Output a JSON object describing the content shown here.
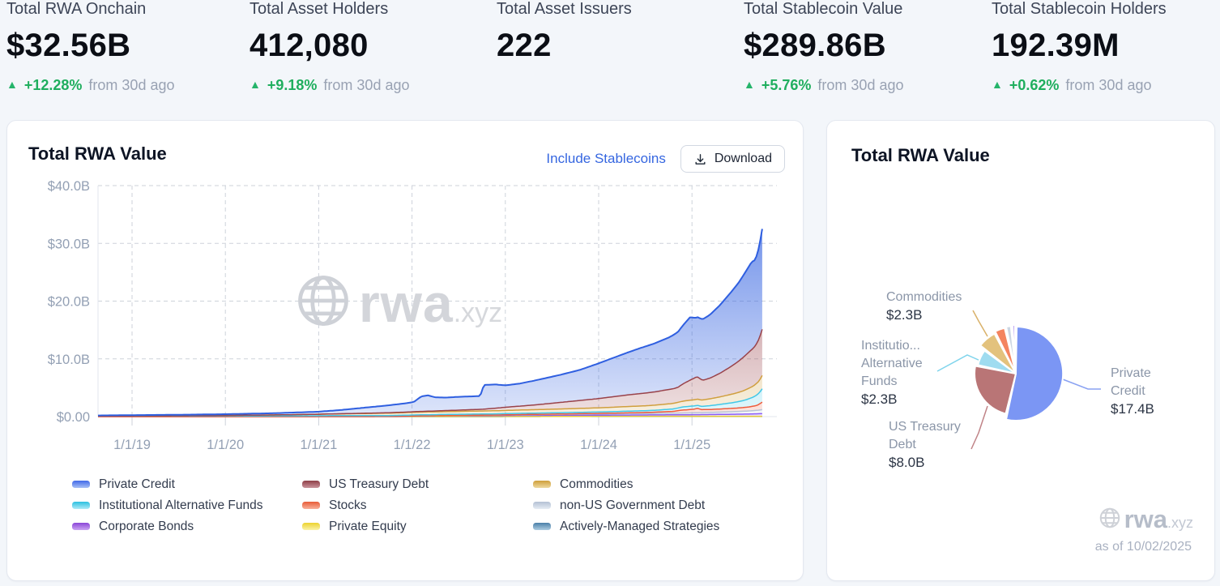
{
  "stats": [
    {
      "label": "Total RWA Onchain",
      "value": "$32.56B",
      "delta": "+12.28%",
      "delta_suffix": "from 30d ago"
    },
    {
      "label": "Total Asset Holders",
      "value": "412,080",
      "delta": "+9.18%",
      "delta_suffix": "from 30d ago"
    },
    {
      "label": "Total Asset Issuers",
      "value": "222",
      "delta": null,
      "delta_suffix": null
    },
    {
      "label": "Total Stablecoin Value",
      "value": "$289.86B",
      "delta": "+5.76%",
      "delta_suffix": "from 30d ago"
    },
    {
      "label": "Total Stablecoin Holders",
      "value": "192.39M",
      "delta": "+0.62%",
      "delta_suffix": "from 30d ago"
    }
  ],
  "main_card": {
    "title": "Total RWA Value",
    "include_stablecoins_label": "Include Stablecoins",
    "download_label": "Download"
  },
  "side_card": {
    "title": "Total RWA Value",
    "as_of": "as of 10/02/2025"
  },
  "watermark": {
    "text": "rwa",
    "suffix": ".xyz"
  },
  "colors": {
    "page_bg": "#f3f6fa",
    "link_blue": "#3566e0",
    "green_up": "#1fae5e",
    "axis_text": "#93a0b4",
    "grid_line": "#cdd2da"
  },
  "chart_data": [
    {
      "type": "area",
      "stacked": true,
      "title": "Total RWA Value",
      "x_unit": "decimal_years",
      "x_range": [
        2018.635,
        2025.753
      ],
      "ylim": [
        0,
        40
      ],
      "y_ticks": [
        0,
        10,
        20,
        30,
        40
      ],
      "y_tick_labels": [
        "$0.00",
        "$10.0B",
        "$20.0B",
        "$30.0B",
        "$40.0B"
      ],
      "x_ticks": [
        2019,
        2020,
        2021,
        2022,
        2023,
        2024,
        2025
      ],
      "x_tick_labels": [
        "1/1/19",
        "1/1/20",
        "1/1/21",
        "1/1/22",
        "1/1/23",
        "1/1/24",
        "1/1/25"
      ],
      "grid": "dashed",
      "legend_position": "bottom",
      "legend_columns": [
        [
          "Private Credit",
          "Institutional Alternative Funds",
          "Corporate Bonds"
        ],
        [
          "US Treasury Debt",
          "Stocks",
          "Private Equity"
        ],
        [
          "Commodities",
          "non-US Government Debt",
          "Actively-Managed Strategies"
        ]
      ],
      "series": [
        {
          "name": "Actively-Managed Strategies",
          "color": "#4f81ab",
          "swatch": [
            "#4a7fa8",
            "#aecce2"
          ],
          "points": [
            [
              2018.635,
              0
            ],
            [
              2022.9,
              0
            ],
            [
              2023.1,
              0.02
            ],
            [
              2025.753,
              0.03
            ]
          ]
        },
        {
          "name": "Private Equity",
          "color": "#e8cc39",
          "swatch": [
            "#ecd22e",
            "#faf3a8"
          ],
          "points": [
            [
              2018.635,
              0
            ],
            [
              2020.9,
              0
            ],
            [
              2021.1,
              0.02
            ],
            [
              2025.753,
              0.03
            ]
          ]
        },
        {
          "name": "Corporate Bonds",
          "color": "#8b5cf6",
          "swatch": [
            "#8b46d8",
            "#cba4f2"
          ],
          "points": [
            [
              2018.635,
              0
            ],
            [
              2021.75,
              0
            ],
            [
              2021.95,
              0.06
            ],
            [
              2022.05,
              0.1
            ],
            [
              2022.3,
              0.15
            ],
            [
              2023,
              0.17
            ],
            [
              2024,
              0.2
            ],
            [
              2024.9,
              0.26
            ],
            [
              2025.3,
              0.32
            ],
            [
              2025.6,
              0.38
            ],
            [
              2025.753,
              0.45
            ]
          ]
        },
        {
          "name": "non-US Government Debt",
          "color": "#b8c4d6",
          "swatch": [
            "#b3c0d4",
            "#e6ecf4"
          ],
          "points": [
            [
              2018.635,
              0
            ],
            [
              2022.25,
              0
            ],
            [
              2022.6,
              0.05
            ],
            [
              2023,
              0.1
            ],
            [
              2023.5,
              0.15
            ],
            [
              2024,
              0.2
            ],
            [
              2024.6,
              0.26
            ],
            [
              2025,
              0.32
            ],
            [
              2025.3,
              0.4
            ],
            [
              2025.55,
              0.5
            ],
            [
              2025.7,
              0.6
            ],
            [
              2025.753,
              0.7
            ]
          ]
        },
        {
          "name": "Stocks",
          "color": "#ef5b3b",
          "swatch": [
            "#e85c38",
            "#f8b09a"
          ],
          "points": [
            [
              2018.635,
              0
            ],
            [
              2022.9,
              0
            ],
            [
              2023.5,
              0.05
            ],
            [
              2024,
              0.1
            ],
            [
              2024.5,
              0.18
            ],
            [
              2024.8,
              0.3
            ],
            [
              2024.88,
              0.5
            ],
            [
              2024.95,
              0.55
            ],
            [
              2025.02,
              0.62
            ],
            [
              2025.06,
              0.75
            ],
            [
              2025.1,
              0.52
            ],
            [
              2025.2,
              0.5
            ],
            [
              2025.35,
              0.55
            ],
            [
              2025.5,
              0.6
            ],
            [
              2025.6,
              0.68
            ],
            [
              2025.68,
              0.8
            ],
            [
              2025.72,
              1.0
            ],
            [
              2025.753,
              1.3
            ]
          ]
        },
        {
          "name": "Institutional Alternative Funds",
          "color": "#41c8e8",
          "swatch": [
            "#2cc0e0",
            "#aeeaf8"
          ],
          "points": [
            [
              2018.635,
              0.1
            ],
            [
              2019.5,
              0.1
            ],
            [
              2020,
              0.1
            ],
            [
              2021,
              0.14
            ],
            [
              2022,
              0.17
            ],
            [
              2023,
              0.2
            ],
            [
              2024,
              0.25
            ],
            [
              2024.6,
              0.32
            ],
            [
              2024.85,
              0.45
            ],
            [
              2024.92,
              0.55
            ],
            [
              2025,
              0.58
            ],
            [
              2025.06,
              0.52
            ],
            [
              2025.15,
              0.6
            ],
            [
              2025.3,
              0.8
            ],
            [
              2025.45,
              1.0
            ],
            [
              2025.55,
              1.2
            ],
            [
              2025.65,
              1.55
            ],
            [
              2025.72,
              1.95
            ],
            [
              2025.753,
              2.3
            ]
          ]
        },
        {
          "name": "Commodities",
          "color": "#d09f3e",
          "swatch": [
            "#cf9f3a",
            "#eed9a0"
          ],
          "points": [
            [
              2018.635,
              0.02
            ],
            [
              2019.5,
              0.05
            ],
            [
              2020,
              0.1
            ],
            [
              2020.5,
              0.16
            ],
            [
              2021,
              0.26
            ],
            [
              2021.5,
              0.36
            ],
            [
              2022,
              0.46
            ],
            [
              2022.5,
              0.5
            ],
            [
              2023,
              0.55
            ],
            [
              2023.5,
              0.62
            ],
            [
              2024,
              0.72
            ],
            [
              2024.5,
              0.85
            ],
            [
              2024.9,
              1.0
            ],
            [
              2025.1,
              1.1
            ],
            [
              2025.3,
              1.3
            ],
            [
              2025.5,
              1.6
            ],
            [
              2025.65,
              1.9
            ],
            [
              2025.72,
              2.1
            ],
            [
              2025.753,
              2.3
            ]
          ]
        },
        {
          "name": "US Treasury Debt",
          "color": "#99424a",
          "swatch": [
            "#8f3f48",
            "#c9939b"
          ],
          "points": [
            [
              2018.635,
              0
            ],
            [
              2021,
              0
            ],
            [
              2021.5,
              0.05
            ],
            [
              2022,
              0.1
            ],
            [
              2022.5,
              0.22
            ],
            [
              2022.76,
              0.3
            ],
            [
              2023,
              0.55
            ],
            [
              2023.3,
              0.8
            ],
            [
              2023.6,
              1.15
            ],
            [
              2024,
              1.6
            ],
            [
              2024.3,
              2.0
            ],
            [
              2024.6,
              2.3
            ],
            [
              2024.85,
              2.6
            ],
            [
              2024.92,
              3.1
            ],
            [
              2025,
              3.6
            ],
            [
              2025.05,
              3.9
            ],
            [
              2025.12,
              3.4
            ],
            [
              2025.2,
              3.6
            ],
            [
              2025.3,
              4.1
            ],
            [
              2025.4,
              4.7
            ],
            [
              2025.5,
              5.4
            ],
            [
              2025.6,
              6.2
            ],
            [
              2025.68,
              6.7
            ],
            [
              2025.72,
              7.3
            ],
            [
              2025.753,
              8.0
            ]
          ]
        },
        {
          "name": "Private Credit",
          "color": "#2f5fe0",
          "swatch": [
            "#4169e8",
            "#a8c0f5"
          ],
          "points": [
            [
              2018.635,
              0.08
            ],
            [
              2019,
              0.12
            ],
            [
              2019.5,
              0.17
            ],
            [
              2020,
              0.22
            ],
            [
              2020.5,
              0.3
            ],
            [
              2021,
              0.45
            ],
            [
              2021.2,
              0.6
            ],
            [
              2021.4,
              0.85
            ],
            [
              2021.6,
              1.1
            ],
            [
              2021.8,
              1.35
            ],
            [
              2021.95,
              1.55
            ],
            [
              2022.02,
              1.7
            ],
            [
              2022.1,
              2.6
            ],
            [
              2022.17,
              2.75
            ],
            [
              2022.25,
              2.35
            ],
            [
              2022.35,
              2.25
            ],
            [
              2022.5,
              2.3
            ],
            [
              2022.65,
              2.3
            ],
            [
              2022.73,
              2.3
            ],
            [
              2022.77,
              4.2
            ],
            [
              2022.9,
              4.1
            ],
            [
              2023,
              3.8
            ],
            [
              2023.15,
              3.9
            ],
            [
              2023.3,
              4.2
            ],
            [
              2023.45,
              4.5
            ],
            [
              2023.6,
              4.8
            ],
            [
              2023.8,
              5.3
            ],
            [
              2024,
              6.1
            ],
            [
              2024.15,
              6.7
            ],
            [
              2024.3,
              7.3
            ],
            [
              2024.45,
              7.9
            ],
            [
              2024.6,
              8.4
            ],
            [
              2024.75,
              9.0
            ],
            [
              2024.85,
              9.6
            ],
            [
              2024.92,
              10.3
            ],
            [
              2024.98,
              10.9
            ],
            [
              2025.04,
              10.3
            ],
            [
              2025.1,
              10.5
            ],
            [
              2025.18,
              10.9
            ],
            [
              2025.3,
              11.8
            ],
            [
              2025.4,
              12.7
            ],
            [
              2025.5,
              13.6
            ],
            [
              2025.58,
              14.5
            ],
            [
              2025.64,
              15.2
            ],
            [
              2025.68,
              14.9
            ],
            [
              2025.72,
              15.9
            ],
            [
              2025.753,
              17.4
            ]
          ]
        }
      ]
    },
    {
      "type": "pie",
      "title": "Total RWA Value",
      "unit": "USD_billions",
      "slices": [
        {
          "label": "Private Credit",
          "value": 17.4,
          "display": "$17.4B",
          "color": "#7b96f4"
        },
        {
          "label": "US Treasury Debt",
          "value": 8.0,
          "display": "$8.0B",
          "color": "#b97576"
        },
        {
          "label": "Institutional Alternative Funds",
          "value": 2.3,
          "display": "$2.3B",
          "color": "#9fdcf0"
        },
        {
          "label": "Commodities",
          "value": 2.3,
          "display": "$2.3B",
          "color": "#e3c27d"
        },
        {
          "label": "Stocks",
          "value": 1.3,
          "color": "#f4845f"
        },
        {
          "label": "non-US Government Debt",
          "value": 0.7,
          "color": "#ccd6e3"
        },
        {
          "label": "Corporate Bonds",
          "value": 0.45,
          "color": "#ab8bf0"
        }
      ],
      "callouts": [
        {
          "slice": "Commodities",
          "lines": [
            "Commodities"
          ],
          "value": "$2.3B"
        },
        {
          "slice": "Institutional Alternative Funds",
          "lines": [
            "Institutio...",
            "Alternative",
            "Funds"
          ],
          "value": "$2.3B"
        },
        {
          "slice": "US Treasury Debt",
          "lines": [
            "US Treasury",
            "Debt"
          ],
          "value": "$8.0B"
        },
        {
          "slice": "Private Credit",
          "lines": [
            "Private",
            "Credit"
          ],
          "value": "$17.4B"
        }
      ],
      "as_of": "as of 10/02/2025"
    }
  ]
}
